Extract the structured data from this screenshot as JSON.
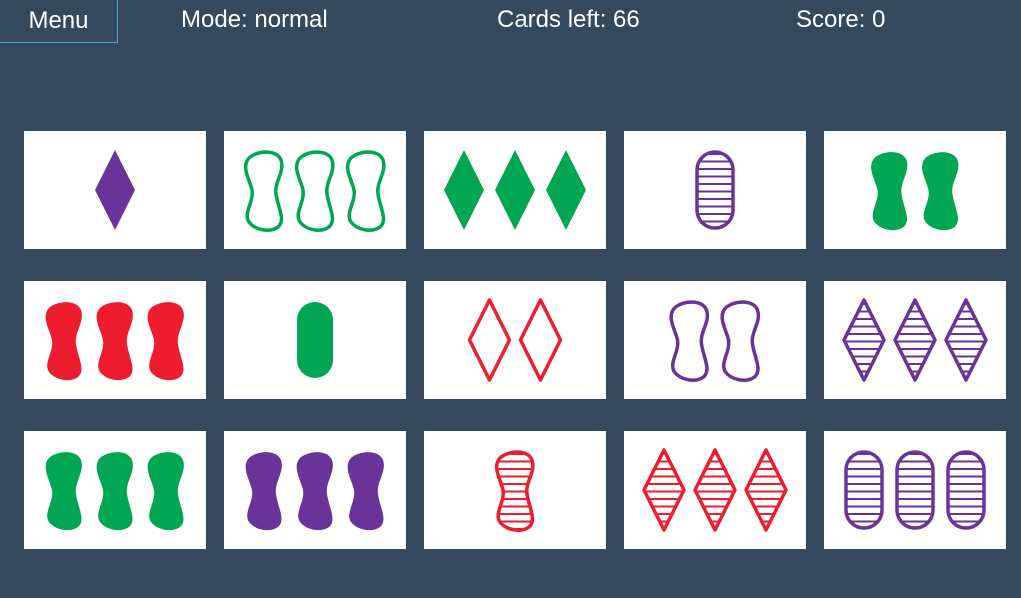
{
  "header": {
    "menu_label": "Menu",
    "mode_label": "Mode: normal",
    "cards_left_label": "Cards left: 66",
    "score_label": "Score: 0"
  },
  "colors": {
    "background": "#34495e",
    "card": "#ffffff",
    "red": "#ed1c2e",
    "green": "#00a651",
    "purple": "#6a3399",
    "menu_border": "#4aa3df"
  },
  "cards": [
    {
      "count": 1,
      "shape": "diamond",
      "color": "purple",
      "fill": "solid"
    },
    {
      "count": 3,
      "shape": "squiggle",
      "color": "green",
      "fill": "empty"
    },
    {
      "count": 3,
      "shape": "diamond",
      "color": "green",
      "fill": "solid"
    },
    {
      "count": 1,
      "shape": "oval",
      "color": "purple",
      "fill": "striped"
    },
    {
      "count": 2,
      "shape": "squiggle",
      "color": "green",
      "fill": "solid"
    },
    {
      "count": 3,
      "shape": "squiggle",
      "color": "red",
      "fill": "solid"
    },
    {
      "count": 1,
      "shape": "oval",
      "color": "green",
      "fill": "solid"
    },
    {
      "count": 2,
      "shape": "diamond",
      "color": "red",
      "fill": "empty"
    },
    {
      "count": 2,
      "shape": "squiggle",
      "color": "purple",
      "fill": "empty"
    },
    {
      "count": 3,
      "shape": "diamond",
      "color": "purple",
      "fill": "striped"
    },
    {
      "count": 3,
      "shape": "squiggle",
      "color": "green",
      "fill": "solid"
    },
    {
      "count": 3,
      "shape": "squiggle",
      "color": "purple",
      "fill": "solid"
    },
    {
      "count": 1,
      "shape": "squiggle",
      "color": "red",
      "fill": "striped"
    },
    {
      "count": 3,
      "shape": "diamond",
      "color": "red",
      "fill": "striped"
    },
    {
      "count": 3,
      "shape": "oval",
      "color": "purple",
      "fill": "striped"
    }
  ]
}
